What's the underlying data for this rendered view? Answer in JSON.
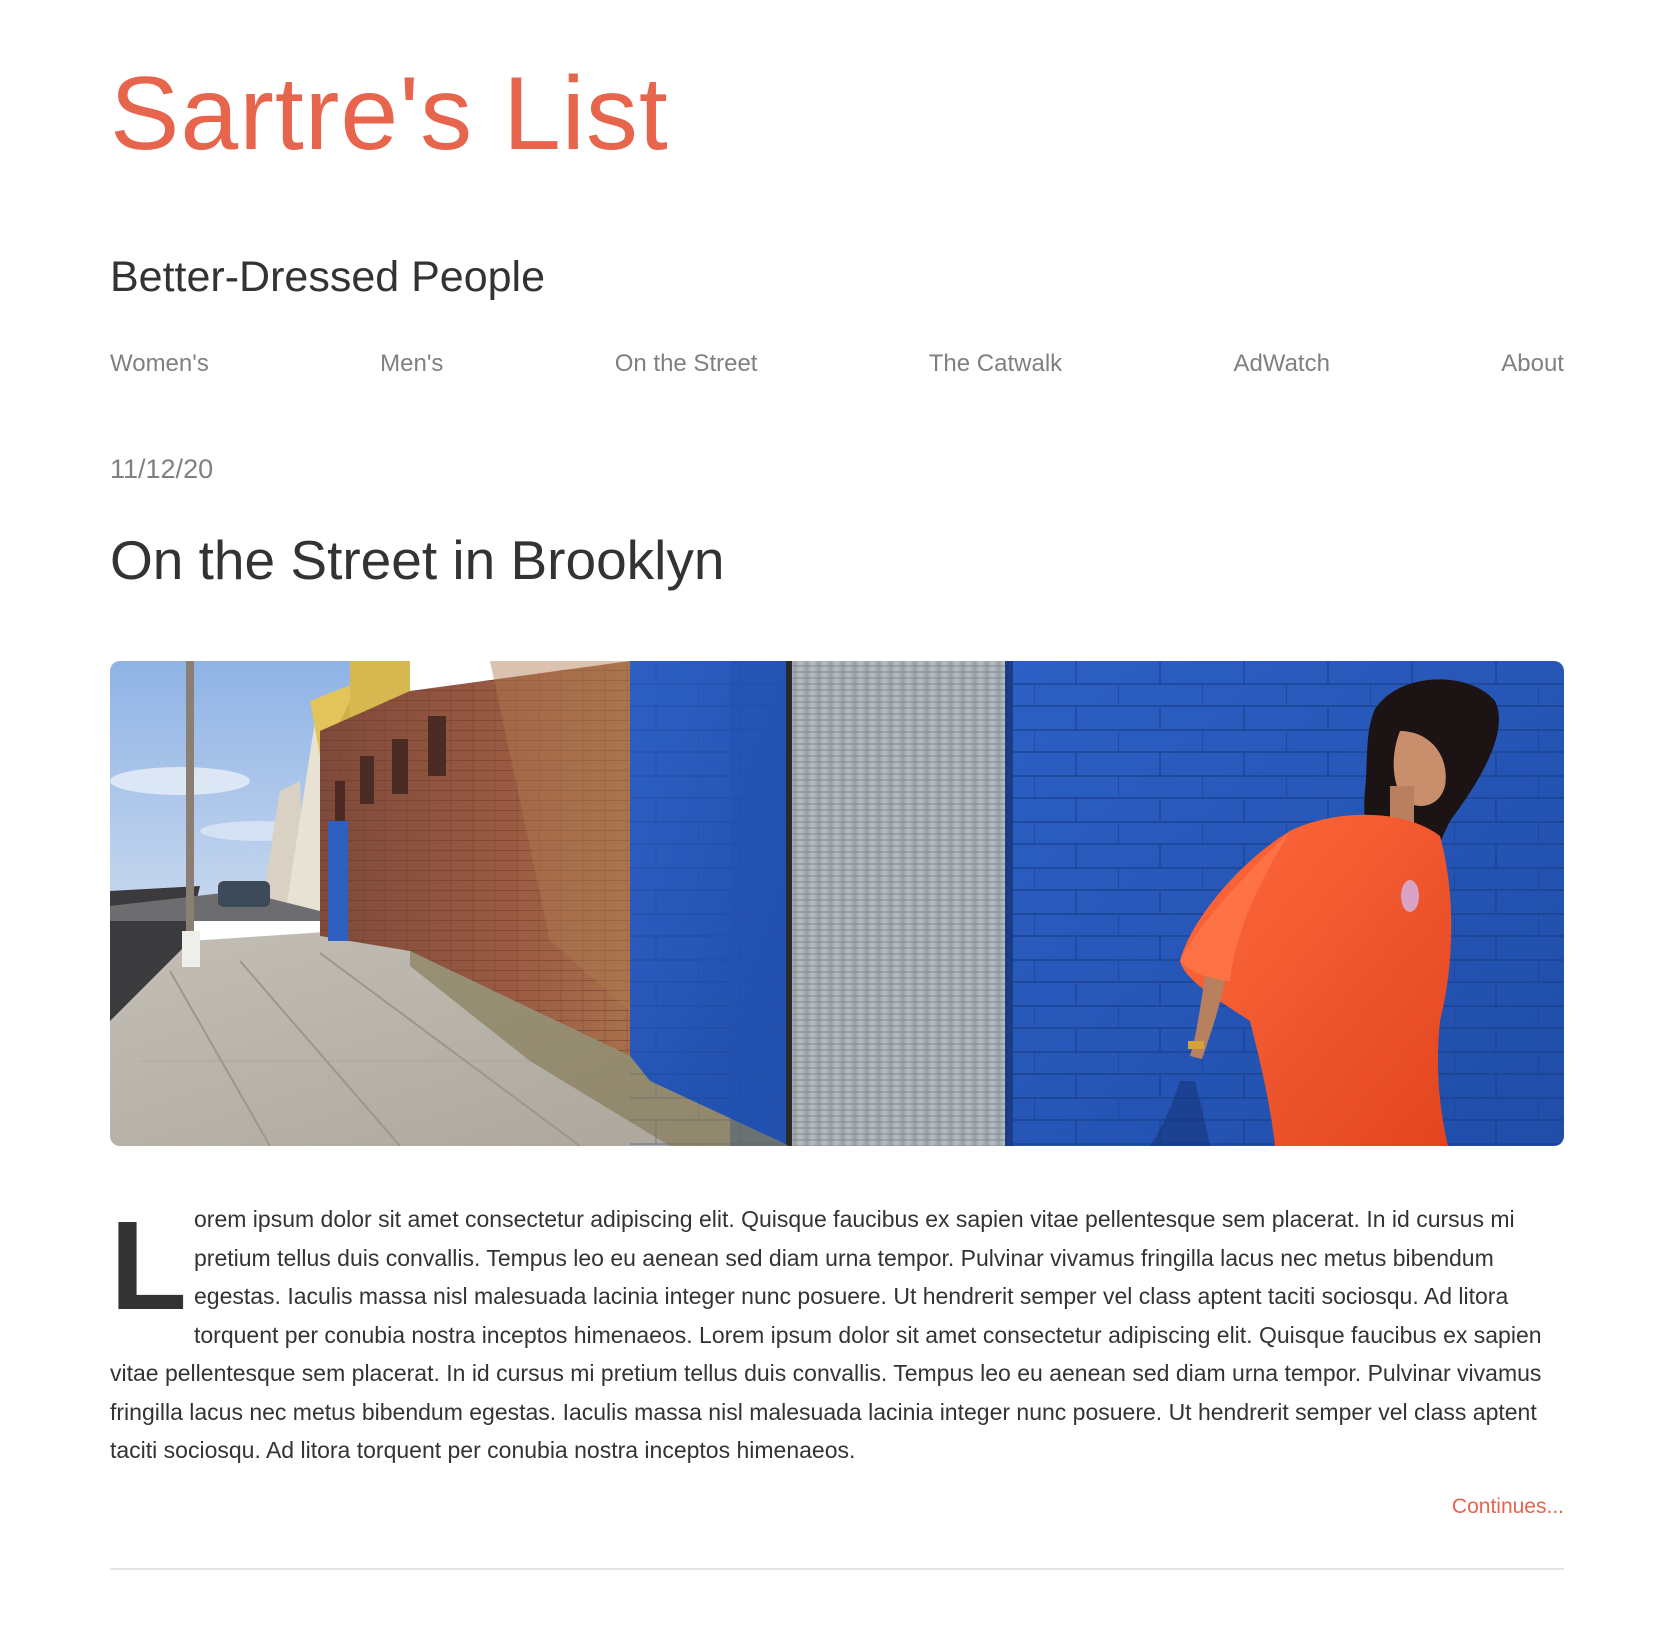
{
  "site": {
    "title": "Sartre's List",
    "tagline": "Better-Dressed People",
    "accent_color": "#e8654d"
  },
  "nav": {
    "items": [
      {
        "label": "Women's"
      },
      {
        "label": "Men's"
      },
      {
        "label": "On the Street"
      },
      {
        "label": "The Catwalk"
      },
      {
        "label": "AdWatch"
      },
      {
        "label": "About"
      }
    ]
  },
  "post": {
    "date": "11/12/20",
    "title": "On the Street in Brooklyn",
    "image_subject": "street-photo-woman-orange-dress-blue-wall",
    "drop_cap": "L",
    "body": "orem ipsum dolor sit amet consectetur adipiscing elit. Quisque faucibus ex sapien vitae pellentesque sem placerat. In id cursus mi pretium tellus duis convallis. Tempus leo eu aenean sed diam urna tempor. Pulvinar vivamus fringilla lacus nec metus bibendum egestas. Iaculis massa nisl malesuada lacinia integer nunc posuere. Ut hendrerit semper vel class aptent taciti sociosqu. Ad litora torquent per conubia nostra inceptos himenaeos. Lorem ipsum dolor sit amet consectetur adipiscing elit. Quisque faucibus ex sapien vitae pellentesque sem placerat. In id cursus mi pretium tellus duis convallis. Tempus leo eu aenean sed diam urna tempor. Pulvinar vivamus fringilla lacus nec metus bibendum egestas. Iaculis massa nisl malesuada lacinia integer nunc posuere. Ut hendrerit semper vel class aptent taciti sociosqu. Ad litora torquent per conubia nostra inceptos himenaeos.",
    "continue_label": "Continues..."
  }
}
